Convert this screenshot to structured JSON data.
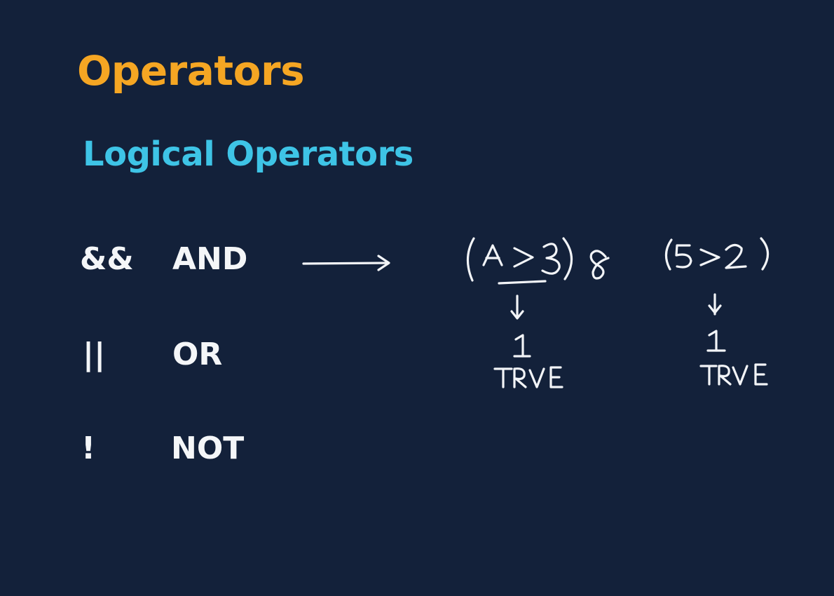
{
  "slide": {
    "title": "Operators",
    "subtitle": "Logical Operators",
    "operators": [
      {
        "symbol": "&&",
        "name": "AND"
      },
      {
        "symbol": "||",
        "name": "OR"
      },
      {
        "symbol": "!",
        "name": "NOT"
      }
    ]
  },
  "annotation": {
    "expression_left": "(A > 3) &",
    "expression_right": "(5>2)",
    "left_result_value": "1",
    "left_result_label": "TRUE",
    "right_result_value": "1",
    "right_result_label": "TRUE"
  },
  "colors": {
    "background": "#13213a",
    "title": "#f5a623",
    "subtitle": "#3ec4e6",
    "text": "#f4f6f8",
    "ink": "#f2f4f7"
  }
}
